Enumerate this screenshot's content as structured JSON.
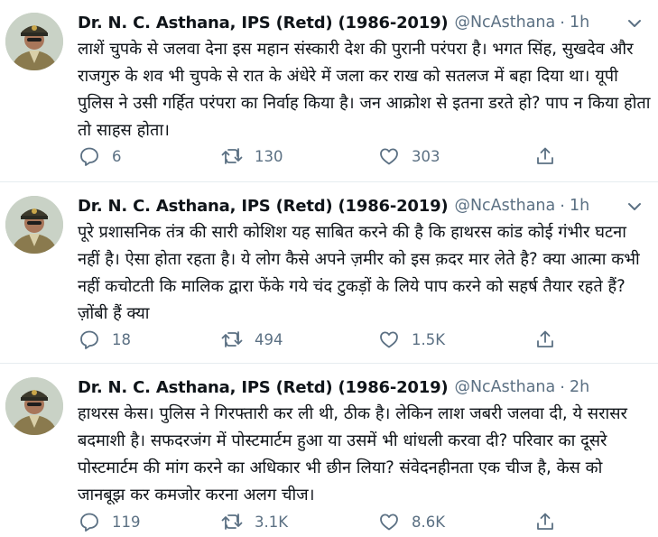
{
  "tweets": [
    {
      "author": "Dr. N. C. Asthana, IPS (Retd) (1986-2019)",
      "handle": "@NcAsthana",
      "separator": "·",
      "time": "1h",
      "text": "लाशें चुपके से जलवा देना इस महान संस्कारी देश की पुरानी परंपरा है। भगत सिंह, सुखदेव और राजगुरु के शव भी चुपके से रात के अंधेरे में जला कर राख को सतलज में बहा दिया था। यूपी पुलिस ने उसी गर्हित परंपरा का निर्वाह किया है। जन आक्रोश से इतना डरते हो? पाप न किया होता तो साहस होता।",
      "replies": "6",
      "retweets": "130",
      "likes": "303"
    },
    {
      "author": "Dr. N. C. Asthana, IPS (Retd) (1986-2019)",
      "handle": "@NcAsthana",
      "separator": "·",
      "time": "1h",
      "text": "पूरे प्रशासनिक तंत्र की सारी कोशिश यह साबित करने की है कि हाथरस कांड कोई गंभीर घटना नहीं है। ऐसा होता रहता है। ये लोग कैसे अपने ज़मीर को इस क़दर मार लेते है? क्या आत्मा कभी नहीं कचोटती कि मालिक द्वारा फेंके गये चंद टुकड़ों के लिये पाप करने को सहर्ष तैयार रहते हैं? ज़ोंबी हैं क्या",
      "replies": "18",
      "retweets": "494",
      "likes": "1.5K"
    },
    {
      "author": "Dr. N. C. Asthana, IPS (Retd) (1986-2019)",
      "handle": "@NcAsthana",
      "separator": "·",
      "time": "2h",
      "text": "हाथरस केस। पुलिस ने गिरफ्तारी कर ली थी, ठीक है। लेकिन लाश जबरी जलवा दी, ये सरासर बदमाशी है। सफदरजंग में पोस्टमार्टम हुआ या उसमें भी धांधली करवा दी? परिवार का दूसरे पोस्टमार्टम की मांग करने का अधिकार भी छीन लिया? संवेदनहीनता एक चीज है, केस को जानबूझ कर कमजोर करना अलग चीज।",
      "replies": "119",
      "retweets": "3.1K",
      "likes": "8.6K"
    }
  ],
  "icons": {
    "more": "chevron-down-icon",
    "reply": "reply-icon",
    "retweet": "retweet-icon",
    "like": "like-icon",
    "share": "share-icon"
  },
  "colors": {
    "text": "#0f1419",
    "secondary": "#5b7083",
    "divider": "#e6ecf0"
  }
}
